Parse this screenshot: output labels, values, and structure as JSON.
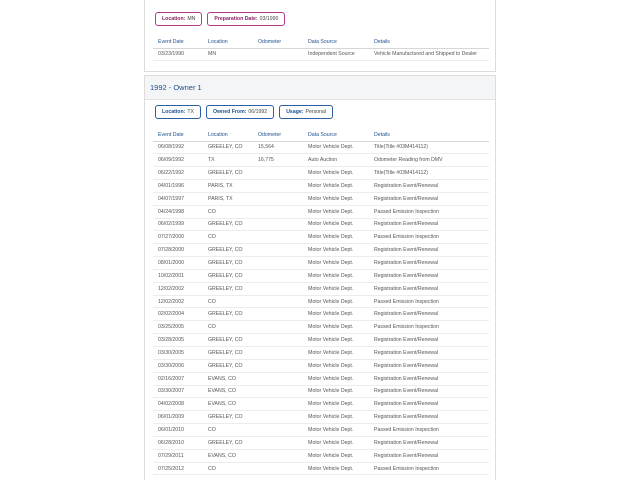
{
  "top_section": {
    "badges": [
      {
        "label": "Location:",
        "value": "MN"
      },
      {
        "label": "Preparation Date:",
        "value": "03/1990"
      }
    ],
    "columns": [
      "Event Date",
      "Location",
      "Odometer",
      "Data Source",
      "Details"
    ],
    "rows": [
      [
        "03/23/1990",
        "MN",
        "",
        "Independent Source",
        "Vehicle Manufactured and Shipped to Dealer"
      ]
    ]
  },
  "owner_section": {
    "title": "1992 - Owner   1",
    "badges": [
      {
        "label": "Location:",
        "value": "TX"
      },
      {
        "label": "Owned From:",
        "value": "06/1992"
      },
      {
        "label": "Usage:",
        "value": "Personal"
      }
    ],
    "columns": [
      "Event Date",
      "Location",
      "Odometer",
      "Data Source",
      "Details"
    ],
    "rows": [
      [
        "06/08/1992",
        "GREELEY, CO",
        "15,564",
        "Motor Vehicle Dept.",
        "Title(Title #03M414112)"
      ],
      [
        "06/09/1992",
        "TX",
        "16,775",
        "Auto Auction",
        "Odometer Reading from DMV"
      ],
      [
        "06/22/1992",
        "GREELEY, CO",
        "",
        "Motor Vehicle Dept.",
        "Title(Title #03M414112)"
      ],
      [
        "04/01/1996",
        "PARIS, TX",
        "",
        "Motor Vehicle Dept.",
        "Registration Event/Renewal"
      ],
      [
        "04/07/1997",
        "PARIS, TX",
        "",
        "Motor Vehicle Dept.",
        "Registration Event/Renewal"
      ],
      [
        "04/24/1998",
        "CO",
        "",
        "Motor Vehicle Dept.",
        "Passed Emission Inspection"
      ],
      [
        "06/02/1999",
        "GREELEY, CO",
        "",
        "Motor Vehicle Dept.",
        "Registration Event/Renewal"
      ],
      [
        "07/27/2000",
        "CO",
        "",
        "Motor Vehicle Dept.",
        "Passed Emission Inspection"
      ],
      [
        "07/28/2000",
        "GREELEY, CO",
        "",
        "Motor Vehicle Dept.",
        "Registration Event/Renewal"
      ],
      [
        "08/01/2000",
        "GREELEY, CO",
        "",
        "Motor Vehicle Dept.",
        "Registration Event/Renewal"
      ],
      [
        "10/02/2001",
        "GREELEY, CO",
        "",
        "Motor Vehicle Dept.",
        "Registration Event/Renewal"
      ],
      [
        "12/02/2002",
        "GREELEY, CO",
        "",
        "Motor Vehicle Dept.",
        "Registration Event/Renewal"
      ],
      [
        "12/02/2002",
        "CO",
        "",
        "Motor Vehicle Dept.",
        "Passed Emission Inspection"
      ],
      [
        "02/02/2004",
        "GREELEY, CO",
        "",
        "Motor Vehicle Dept.",
        "Registration Event/Renewal"
      ],
      [
        "03/25/2005",
        "CO",
        "",
        "Motor Vehicle Dept.",
        "Passed Emission Inspection"
      ],
      [
        "03/28/2005",
        "GREELEY, CO",
        "",
        "Motor Vehicle Dept.",
        "Registration Event/Renewal"
      ],
      [
        "03/30/2005",
        "GREELEY, CO",
        "",
        "Motor Vehicle Dept.",
        "Registration Event/Renewal"
      ],
      [
        "03/30/2006",
        "GREELEY, CO",
        "",
        "Motor Vehicle Dept.",
        "Registration Event/Renewal"
      ],
      [
        "02/16/2007",
        "EVANS, CO",
        "",
        "Motor Vehicle Dept.",
        "Registration Event/Renewal"
      ],
      [
        "03/30/2007",
        "EVANS, CO",
        "",
        "Motor Vehicle Dept.",
        "Registration Event/Renewal"
      ],
      [
        "04/02/2008",
        "EVANS, CO",
        "",
        "Motor Vehicle Dept.",
        "Registration Event/Renewal"
      ],
      [
        "06/01/2009",
        "GREELEY, CO",
        "",
        "Motor Vehicle Dept.",
        "Registration Event/Renewal"
      ],
      [
        "06/01/2010",
        "CO",
        "",
        "Motor Vehicle Dept.",
        "Passed Emission Inspection"
      ],
      [
        "06/28/2010",
        "GREELEY, CO",
        "",
        "Motor Vehicle Dept.",
        "Registration Event/Renewal"
      ],
      [
        "07/29/2011",
        "EVANS, CO",
        "",
        "Motor Vehicle Dept.",
        "Registration Event/Renewal"
      ],
      [
        "07/25/2012",
        "CO",
        "",
        "Motor Vehicle Dept.",
        "Passed Emission Inspection"
      ]
    ]
  },
  "colors": {
    "header_blue": "#1f4f8c",
    "badge_magenta": "#b23c8c",
    "badge_blue": "#2b5fa3"
  }
}
